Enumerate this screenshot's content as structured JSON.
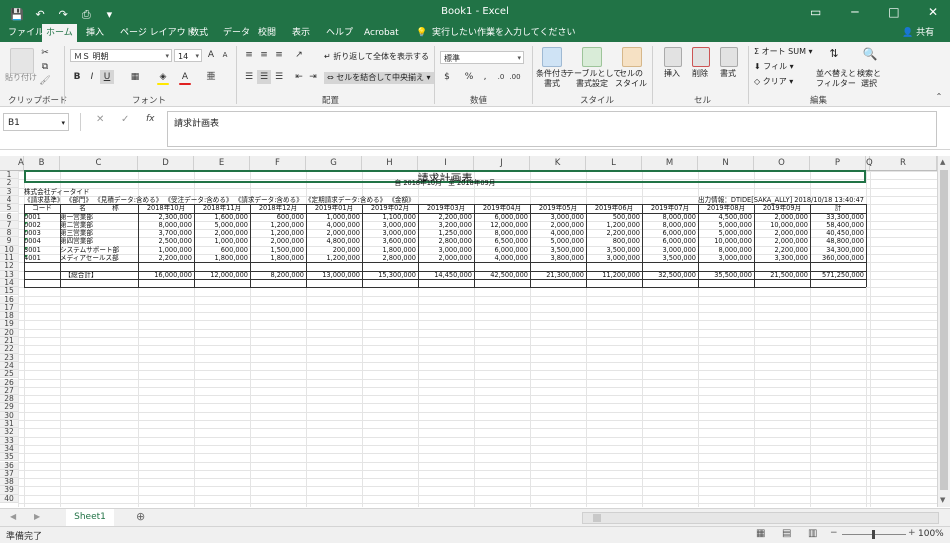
{
  "window": {
    "title": "Book1 - Excel",
    "accent": "#217346"
  },
  "qat": {
    "icons": [
      "save-icon",
      "undo-icon",
      "redo-icon",
      "print-preview-icon",
      "customize-icon"
    ]
  },
  "win_controls": {
    "minimize": "─",
    "restore": "□",
    "close": "✕",
    "ribbon_options": "▭"
  },
  "tabs": [
    "ファイル",
    "ホーム",
    "挿入",
    "ページ レイアウト",
    "数式",
    "データ",
    "校閲",
    "表示",
    "ヘルプ",
    "Acrobat"
  ],
  "tell_me": "実行したい作業を入力してください",
  "share": "共有",
  "ribbon": {
    "clipboard": {
      "label": "クリップボード",
      "paste": "貼り付け"
    },
    "font": {
      "label": "フォント",
      "name": "ＭＳ 明朝",
      "size": "14",
      "bold": "B",
      "italic": "I",
      "underline": "U",
      "grow": "A",
      "shrink": "A"
    },
    "alignment": {
      "label": "配置",
      "wrap": "折り返して全体を表示する",
      "merge": "セルを結合して中央揃え"
    },
    "number": {
      "label": "数値",
      "format": "標準",
      "pct": "%",
      "comma": ","
    },
    "styles": {
      "label": "スタイル",
      "cond": "条件付き\n書式",
      "table": "テーブルとして\n書式設定",
      "cell": "セルの\nスタイル"
    },
    "cells": {
      "label": "セル",
      "insert": "挿入",
      "delete": "削除",
      "format": "書式"
    },
    "editing": {
      "label": "編集",
      "autosum": "オート SUM",
      "fill": "フィル",
      "clear": "クリア",
      "sort": "並べ替えと\nフィルター",
      "find": "検索と\n選択"
    }
  },
  "formula_bar": {
    "name_box": "B1",
    "fx": "fx",
    "cancel": "✕",
    "enter": "✓",
    "value": "請求計画表"
  },
  "columns": [
    "A",
    "B",
    "C",
    "D",
    "E",
    "F",
    "G",
    "H",
    "I",
    "J",
    "K",
    "L",
    "M",
    "N",
    "O",
    "P",
    "Q",
    "R"
  ],
  "rows": [
    "1",
    "2",
    "3",
    "4",
    "5",
    "6",
    "7",
    "8",
    "9",
    "10",
    "11",
    "12",
    "13",
    "14",
    "15",
    "16",
    "17",
    "18",
    "19",
    "20",
    "21",
    "22",
    "23",
    "24",
    "25",
    "26",
    "27",
    "28",
    "29",
    "30",
    "31",
    "32",
    "33",
    "34",
    "35",
    "36",
    "37",
    "38",
    "39",
    "40"
  ],
  "sheet": {
    "title": "請求計画表",
    "period": "自 2018年10月　至 2018年09月",
    "company": "株式会社ディータイド",
    "conditions": "《請求基準》 《部門》 《見積データ:含める》 《受注データ:含める》 《請求データ:含める》 《定期請求データ:含める》 《金額》",
    "output_info": "出力情報：DTIDE[SAKA_ALLY] 2018/10/18 13:40:47",
    "headers": [
      "コード",
      "名　　　　称",
      "2018年10月",
      "2018年11月",
      "2018年12月",
      "2019年01月",
      "2019年02月",
      "2019年03月",
      "2019年04月",
      "2019年05月",
      "2019年06月",
      "2019年07月",
      "2019年08月",
      "2019年09月",
      "計"
    ],
    "data_rows": [
      [
        "0001",
        "第一営業部",
        "2,300,000",
        "1,600,000",
        "600,000",
        "1,000,000",
        "1,100,000",
        "2,200,000",
        "6,000,000",
        "3,000,000",
        "500,000",
        "8,000,000",
        "4,500,000",
        "2,000,000",
        "33,300,000"
      ],
      [
        "0002",
        "第二営業部",
        "8,000,000",
        "5,000,000",
        "1,200,000",
        "4,000,000",
        "3,000,000",
        "3,200,000",
        "12,000,000",
        "2,000,000",
        "1,200,000",
        "8,000,000",
        "5,000,000",
        "10,000,000",
        "58,400,000"
      ],
      [
        "0003",
        "第三営業部",
        "3,700,000",
        "2,000,000",
        "1,200,000",
        "2,000,000",
        "3,000,000",
        "1,250,000",
        "8,000,000",
        "4,000,000",
        "2,200,000",
        "6,000,000",
        "5,000,000",
        "2,000,000",
        "40,450,000"
      ],
      [
        "0004",
        "第四営業部",
        "2,500,000",
        "1,000,000",
        "2,000,000",
        "4,800,000",
        "3,600,000",
        "2,800,000",
        "6,500,000",
        "5,000,000",
        "800,000",
        "6,000,000",
        "10,000,000",
        "2,000,000",
        "48,800,000"
      ],
      [
        "3001",
        "システムサポート部",
        "1,000,000",
        "600,000",
        "1,500,000",
        "200,000",
        "1,800,000",
        "3,000,000",
        "6,000,000",
        "3,500,000",
        "3,500,000",
        "3,000,000",
        "8,000,000",
        "2,200,000",
        "34,300,000"
      ],
      [
        "4001",
        "メディアセールス部",
        "2,200,000",
        "1,800,000",
        "1,800,000",
        "1,200,000",
        "2,800,000",
        "2,000,000",
        "4,000,000",
        "3,800,000",
        "3,000,000",
        "3,500,000",
        "3,000,000",
        "3,300,000",
        "360,000,000"
      ]
    ],
    "total_row": [
      "【総合計】",
      "16,000,000",
      "12,000,000",
      "8,200,000",
      "13,000,000",
      "15,300,000",
      "14,450,000",
      "42,500,000",
      "21,300,000",
      "11,200,000",
      "32,500,000",
      "35,500,000",
      "21,500,000",
      "571,250,000"
    ]
  },
  "sheet_tab": "Sheet1",
  "status": {
    "ready": "準備完了",
    "zoom": "100%"
  }
}
